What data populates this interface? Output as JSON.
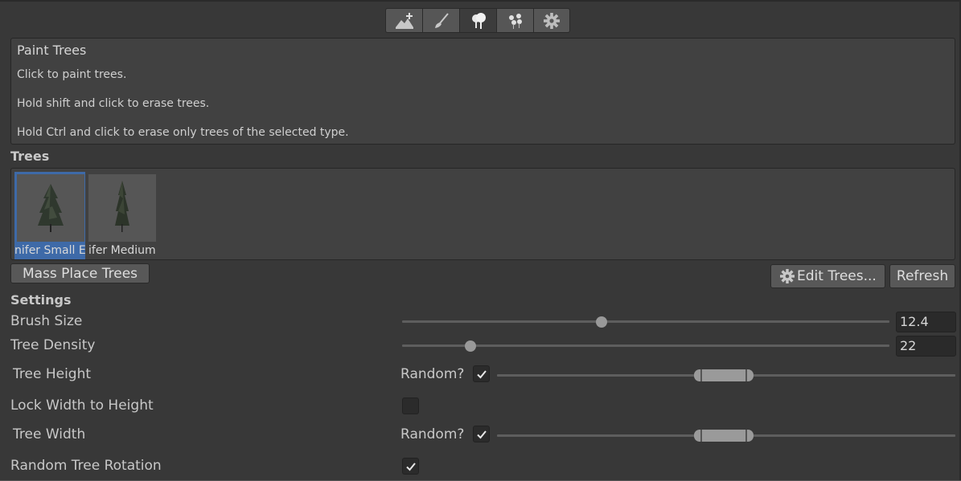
{
  "toolbar": {
    "tools": [
      {
        "name": "raise-lower-terrain",
        "icon": "terrain-add-icon",
        "active": false
      },
      {
        "name": "paint-texture",
        "icon": "paintbrush-icon",
        "active": false
      },
      {
        "name": "paint-trees",
        "icon": "trees-icon",
        "active": true
      },
      {
        "name": "paint-details",
        "icon": "details-flowers-icon",
        "active": false
      },
      {
        "name": "terrain-settings",
        "icon": "gear-icon",
        "active": false
      }
    ]
  },
  "help": {
    "title": "Paint Trees",
    "lines": [
      "Click to paint trees.",
      "Hold shift and click to erase trees.",
      "Hold Ctrl and click to erase only trees of the selected type."
    ]
  },
  "trees": {
    "section_label": "Trees",
    "items": [
      {
        "name": "nifer Small E",
        "selected": true
      },
      {
        "name": "ifer Medium",
        "selected": false
      }
    ],
    "mass_place_label": "Mass Place Trees",
    "edit_trees_label": "Edit Trees...",
    "refresh_label": "Refresh"
  },
  "settings": {
    "section_label": "Settings",
    "brush_size": {
      "label": "Brush Size",
      "value": "12.4",
      "slider_fraction": 0.41
    },
    "tree_density": {
      "label": "Tree Density",
      "value": "22",
      "slider_fraction": 0.14
    },
    "tree_height": {
      "label": "Tree Height",
      "random_label": "Random?",
      "random_checked": true,
      "range_min_fraction": 0.43,
      "range_max_fraction": 0.56
    },
    "lock_width": {
      "label": "Lock Width to Height",
      "checked": false
    },
    "tree_width": {
      "label": "Tree Width",
      "random_label": "Random?",
      "random_checked": true,
      "range_min_fraction": 0.43,
      "range_max_fraction": 0.56
    },
    "random_rotation": {
      "label": "Random Tree Rotation",
      "checked": true
    }
  }
}
